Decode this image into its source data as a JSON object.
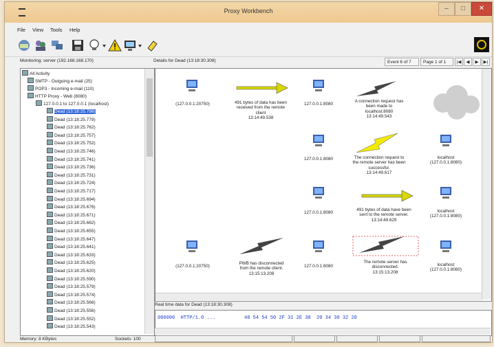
{
  "window": {
    "title": "Proxy Workbench",
    "min": "–",
    "max": "□",
    "close": "✕"
  },
  "menu": [
    "File",
    "View",
    "Tools",
    "Help"
  ],
  "monitoring": "Monitoring: server (192.168.168.170)",
  "details_header": "Details for Dead (13:18:30.308)",
  "nav": {
    "event": "Event 6 of 7",
    "page": "Page 1 of 1",
    "first": "|◀",
    "prev": "◀",
    "next": "▶",
    "last": "▶|"
  },
  "tree": {
    "root": "All Activity",
    "services": [
      "SMTP - Outgoing e-mail (25)",
      "POP3 - Incoming e-mail (110)",
      "HTTP Proxy - Web (8080)"
    ],
    "connection": "127.0.0.1 to 127.0.0.1 (localhost)",
    "items": [
      "Dead (13:18:25.798)",
      "Dead (13:18:25.779)",
      "Dead (13:18:25.762)",
      "Dead (13:18:25.757)",
      "Dead (13:18:25.752)",
      "Dead (13:18:25.746)",
      "Dead (13:18:25.741)",
      "Dead (13:18:25.736)",
      "Dead (13:18:25.731)",
      "Dead (13:18:25.724)",
      "Dead (13:18:25.717)",
      "Dead (13:18:25.694)",
      "Dead (13:18:25.676)",
      "Dead (13:18:25.671)",
      "Dead (13:18:25.662)",
      "Dead (13:18:25.655)",
      "Dead (13:18:25.647)",
      "Dead (13:18:25.641)",
      "Dead (13:18:25.633)",
      "Dead (13:18:25.625)",
      "Dead (13:18:25.620)",
      "Dead (13:18:25.590)",
      "Dead (13:18:25.579)",
      "Dead (13:18:25.574)",
      "Dead (13:18:25.566)",
      "Dead (13:18:25.556)",
      "Dead (13:18:25.552)",
      "Dead (13:18:25.543)"
    ]
  },
  "diagram": {
    "row1": {
      "left": "(127.0.0.1:20750)",
      "arrow": [
        "491 bytes of data has been",
        "received from the remote",
        "client",
        "13:14:49.538"
      ],
      "mid": "127.0.0.1:8080",
      "bolt": [
        "A connection request has",
        "been made to",
        "localhost:8080",
        "13:14:49.543"
      ]
    },
    "row2": {
      "mid": "127.0.0.1:8080",
      "bolt": [
        "The connection request to",
        "the remote server has been",
        "successful.",
        "13:14:49.617"
      ],
      "right": [
        "localhost",
        "(127.0.0.1:8080)"
      ]
    },
    "row3": {
      "mid": "127.0.0.1:8080",
      "arrow": [
        "491 bytes of data have been",
        "sent to the remote server.",
        "13:14:49.629"
      ],
      "right": [
        "localhost",
        "(127.0.0.1:8080)"
      ]
    },
    "row4": {
      "left": "(127.0.0.1:20750)",
      "bolt1": [
        "PWB has disconnected",
        "from the remote client.",
        "13:15:13.208"
      ],
      "mid": "127.0.0.1:8080",
      "bolt2": [
        "The remote server has",
        "disconnected.",
        "13:15:13.208"
      ],
      "right": [
        "localhost",
        "(127.0.0.1:8080)"
      ]
    }
  },
  "realtime": {
    "header": "Real time data for Dead (13:18:30.308)",
    "line": "000000  HTTP/1.0 ...          48 54 54 50 2F 31 2E 30  20 34 30 32 20"
  },
  "status": {
    "memory": "Memory: 8 KBytes",
    "sockets": "Sockets: 100"
  },
  "colors": {
    "titlebar": "#eec890",
    "selection": "#3367d6",
    "hex": "#1a3cc6",
    "arrow": "#e0e000",
    "bolt_yellow": "#f2ea00"
  }
}
